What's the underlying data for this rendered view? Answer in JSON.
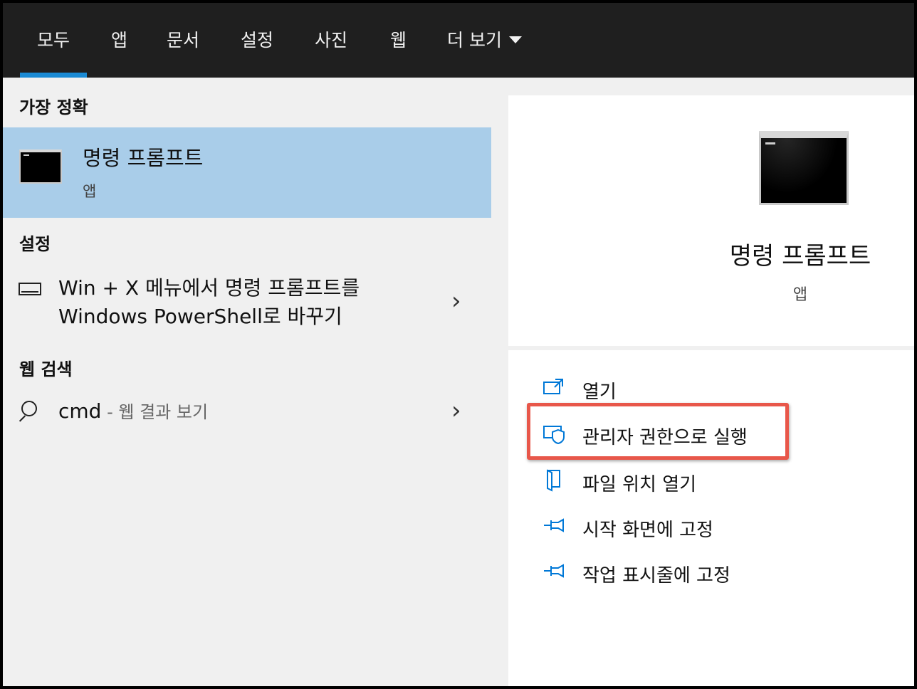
{
  "tabs": [
    {
      "label": "모두",
      "active": true
    },
    {
      "label": "앱"
    },
    {
      "label": "문서"
    },
    {
      "label": "설정"
    },
    {
      "label": "사진"
    },
    {
      "label": "웹"
    },
    {
      "label": "더 보기"
    }
  ],
  "left": {
    "best_match_title": "가장 정확",
    "best_match": {
      "name": "명령 프롬프트",
      "type": "앱"
    },
    "settings_title": "설정",
    "setting_item": "Win + X 메뉴에서 명령 프롬프트를 Windows PowerShell로 바꾸기",
    "web_title": "웹 검색",
    "web_item": {
      "query": "cmd",
      "suffix": " - 웹 결과 보기"
    }
  },
  "right": {
    "app_name": "명령 프롬프트",
    "app_type": "앱",
    "actions": [
      {
        "label": "열기",
        "icon": "open-icon"
      },
      {
        "label": "관리자 권한으로 실행",
        "icon": "shield-icon"
      },
      {
        "label": "파일 위치 열기",
        "icon": "file-location-icon"
      },
      {
        "label": "시작 화면에 고정",
        "icon": "pin-icon"
      },
      {
        "label": "작업 표시줄에 고정",
        "icon": "pin-icon"
      }
    ]
  },
  "colors": {
    "topbar": "#1f1f1f",
    "accent": "#1a8ad4",
    "selection": "#a9cde9",
    "highlight_box": "#e8574a",
    "icon_blue": "#0078d7"
  }
}
